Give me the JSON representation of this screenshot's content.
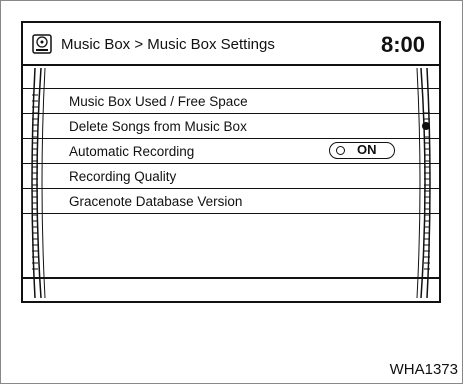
{
  "header": {
    "breadcrumb": "Music Box > Music Box Settings",
    "clock": "8:00",
    "logo_icon": "music-box-icon"
  },
  "menu": {
    "items": [
      {
        "label": "Music Box Used / Free Space"
      },
      {
        "label": "Delete Songs from Music Box"
      },
      {
        "label": "Automatic Recording",
        "toggle": "ON"
      },
      {
        "label": "Recording Quality"
      },
      {
        "label": "Gracenote Database Version"
      }
    ]
  },
  "footer": {
    "code": "WHA1373"
  },
  "colors": {
    "line": "#111111",
    "background": "#ffffff"
  }
}
